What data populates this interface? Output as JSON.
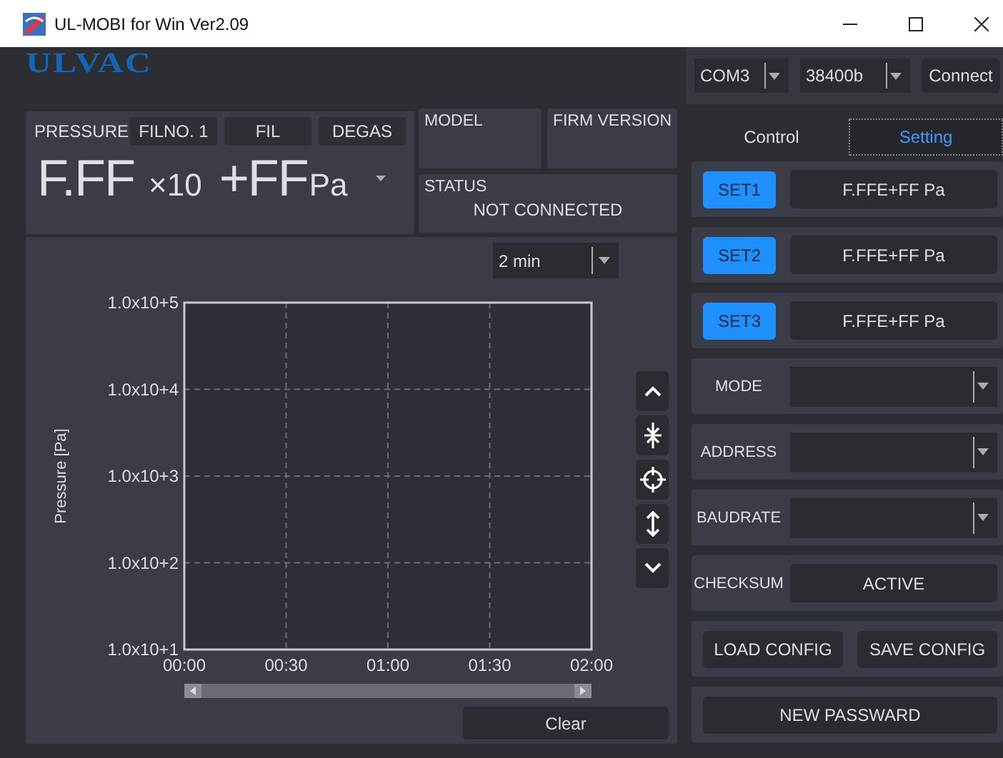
{
  "window": {
    "title": "UL-MOBI for Win Ver2.09"
  },
  "logo": "ULVAC",
  "pressure_panel": {
    "label": "PRESSURE",
    "indicators": [
      "FILNO. 1",
      "FIL",
      "DEGAS"
    ],
    "mantissa": "F.FF",
    "multiplier": "×10",
    "exponent": "+FF",
    "unit": "Pa"
  },
  "model": {
    "label": "MODEL"
  },
  "firm_version": {
    "label": "FIRM VERSION"
  },
  "status": {
    "label": "STATUS",
    "value": "NOT CONNECTED"
  },
  "chart_panel": {
    "range": "2 min",
    "clear_button": "Clear",
    "plot": {
      "y_axis_title": "Pressure [Pa]",
      "x_axis_labels": [
        "00:00",
        "00:30",
        "01:00",
        "01:30",
        "02:00"
      ],
      "y_axis_labels": [
        "1.0x10+5",
        "1.0x10+4",
        "1.0x10+3",
        "1.0x10+2",
        "1.0x10+1"
      ]
    }
  },
  "connection": {
    "port": "COM3",
    "baud": "38400b",
    "connect_button": "Connect"
  },
  "tabs": [
    {
      "label": "Control",
      "selected": false
    },
    {
      "label": "Setting",
      "selected": true
    }
  ],
  "setpoints": [
    {
      "label": "SET1",
      "value": "F.FFE+FF Pa"
    },
    {
      "label": "SET2",
      "value": "F.FFE+FF Pa"
    },
    {
      "label": "SET3",
      "value": "F.FFE+FF Pa"
    }
  ],
  "settings": [
    {
      "kind": "select",
      "label": "MODE"
    },
    {
      "kind": "select",
      "label": "ADDRESS"
    },
    {
      "kind": "select",
      "label": "BAUDRATE"
    },
    {
      "kind": "button",
      "label": "CHECKSUM",
      "value": "ACTIVE"
    }
  ],
  "config_buttons": [
    "LOAD CONFIG",
    "SAVE CONFIG"
  ],
  "password_button": "NEW PASSWARD"
}
